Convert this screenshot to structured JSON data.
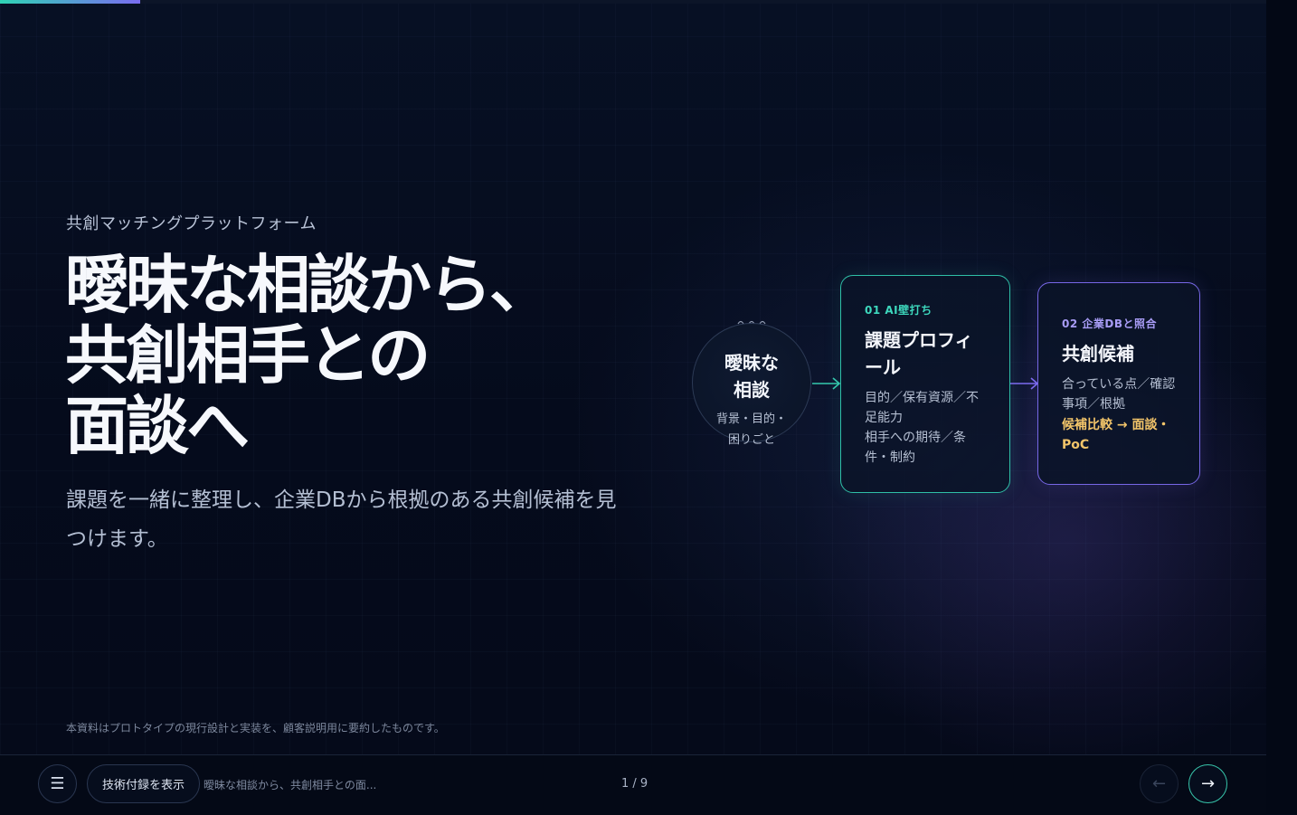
{
  "progress": {
    "current": 1,
    "total": 9,
    "fraction": 0.111
  },
  "hero": {
    "eyebrow": "共創マッチングプラットフォーム",
    "title_lines": [
      "曖昧な相談から、",
      "共創相手との",
      "面談へ"
    ],
    "subtitle": "課題を一緒に整理し、企業DBから根拠のある共創候補を見つけます。"
  },
  "flow": {
    "start": {
      "title_lines": [
        "曖昧な",
        "相談"
      ],
      "sub_lines": [
        "背景・目的・",
        "困りごと"
      ]
    },
    "step1": {
      "label": "01 AI壁打ち",
      "title": "課題プロフィール",
      "body": "目的／保有資源／不足能力",
      "body2": "相手への期待／条件・制約"
    },
    "step2": {
      "label": "02 企業DBと照合",
      "title": "共創候補",
      "body": "合っている点／確認事項／根拠",
      "highlight": "候補比較 → 面談・PoC"
    }
  },
  "footnote": "本資料はプロトタイプの現行設計と実装を、顧客説明用に要約したものです。",
  "nav": {
    "menu_icon": "☰",
    "appendix_label": "技術付録を表示",
    "slide_title": "曖昧な相談から、共創相手との面...",
    "page_indicator": "1 / 9",
    "prev_icon": "←",
    "next_icon": "→"
  },
  "colors": {
    "background": "#040a19",
    "accent_teal": "#2fbfa7",
    "accent_violet": "#7767e6",
    "highlight_gold": "#f3c56a"
  }
}
